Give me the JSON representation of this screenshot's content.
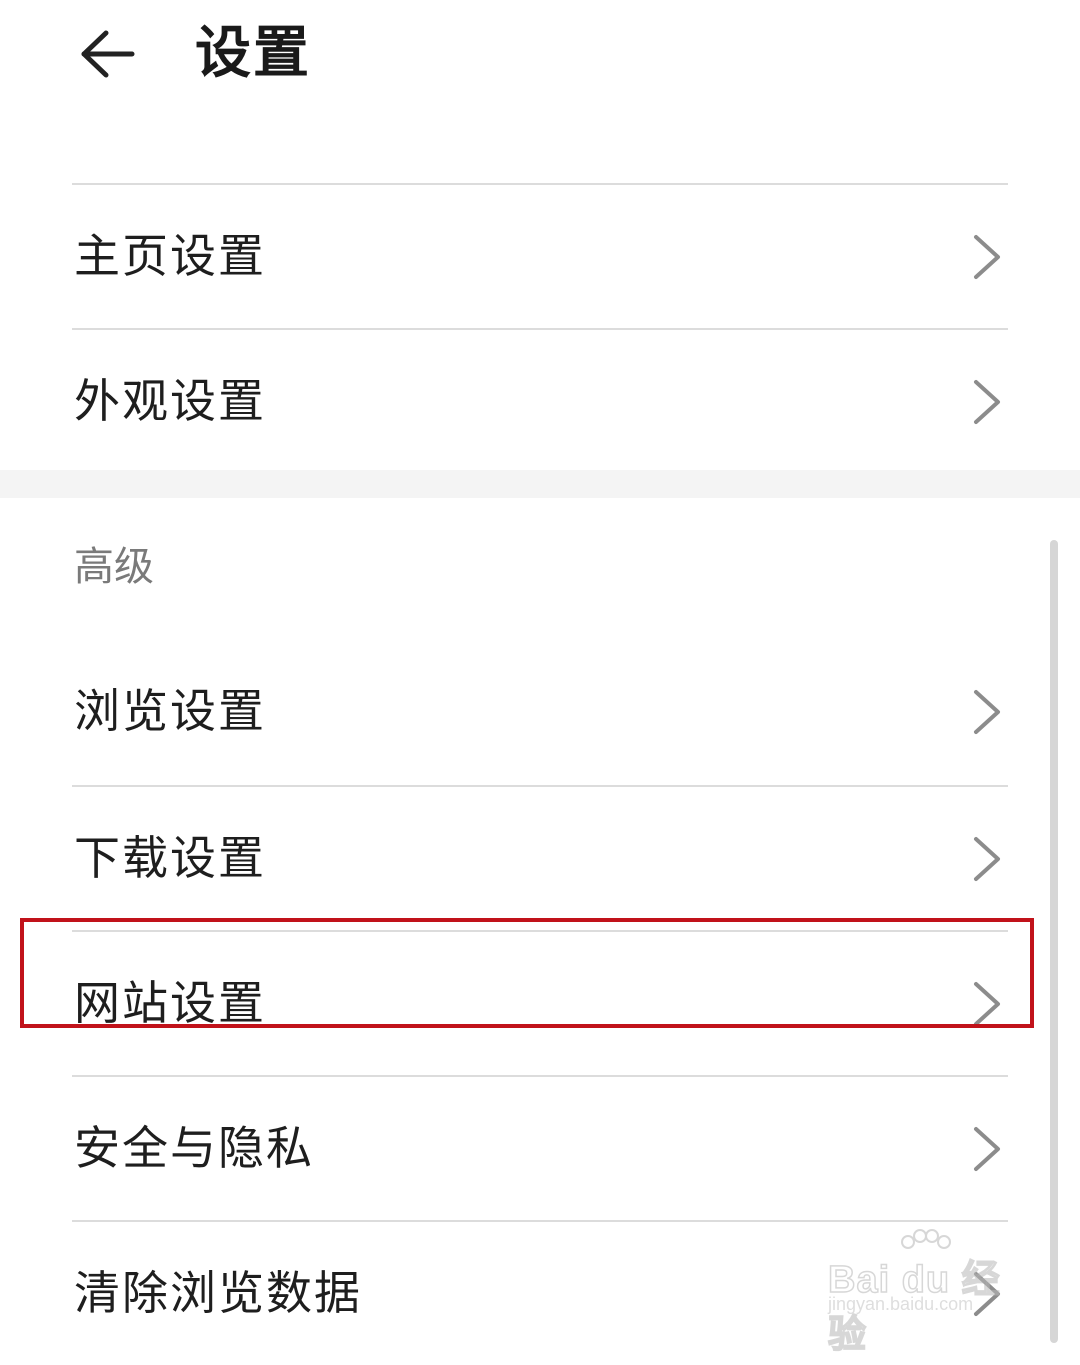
{
  "header": {
    "title": "设置"
  },
  "group_basic": {
    "items": [
      {
        "label": "主页设置"
      },
      {
        "label": "外观设置"
      }
    ]
  },
  "group_advanced": {
    "section_title": "高级",
    "items": [
      {
        "label": "浏览设置"
      },
      {
        "label": "下载设置"
      },
      {
        "label": "网站设置",
        "highlighted": true
      },
      {
        "label": "安全与隐私"
      },
      {
        "label": "清除浏览数据"
      }
    ]
  },
  "watermark": {
    "brand": "Bai du 经验",
    "url": "jingyan.baidu.com"
  },
  "colors": {
    "highlight": "#c1121a",
    "divider": "#dcdcdc",
    "section_text": "#7a7a7a",
    "chevron": "#8c8c8c"
  },
  "icons": {
    "back": "back-arrow-icon",
    "row_chevron": "chevron-right-icon"
  }
}
